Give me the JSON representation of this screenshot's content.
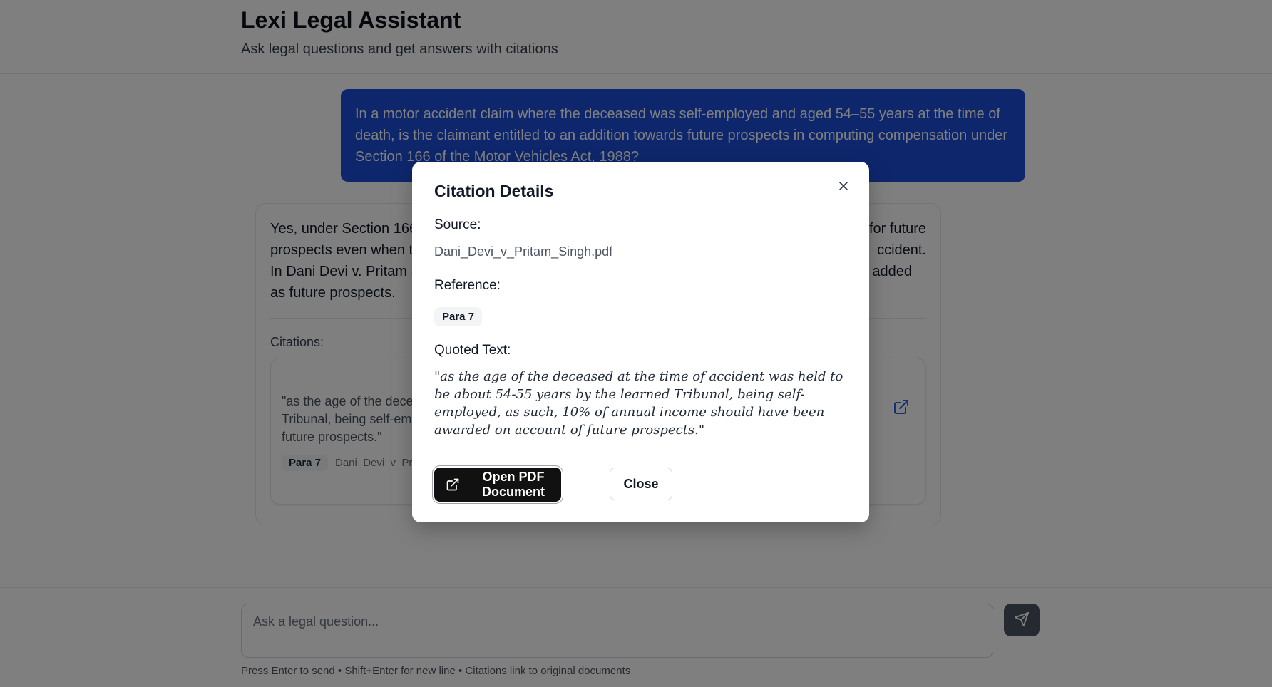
{
  "header": {
    "title": "Lexi Legal Assistant",
    "subtitle": "Ask legal questions and get answers with citations"
  },
  "conversation": {
    "user_message": "In a motor accident claim where the deceased was self-employed and aged 54–55 years at the time of death, is the claimant entitled to an addition towards future prospects in computing compensation under Section 166 of the Motor Vehicles Act, 1988?",
    "assistant_answer_visible_left": [
      "Yes, under Section 166",
      "prospects even when th",
      "In Dani Devi v. Pritam S",
      "as future prospects."
    ],
    "assistant_answer_visible_right": [
      "for future",
      "ccident.",
      "added"
    ],
    "citations_label": "Citations:",
    "citation": {
      "quote_visible_lines": [
        "\"as the age of the dece",
        "Tribunal, being self-emp",
        "future prospects.\""
      ],
      "para": "Para 7",
      "file_visible": "Dani_Devi_v_Prit"
    }
  },
  "modal": {
    "title": "Citation Details",
    "source_label": "Source:",
    "source_value": "Dani_Devi_v_Pritam_Singh.pdf",
    "reference_label": "Reference:",
    "reference_value": "Para 7",
    "quoted_label": "Quoted Text:",
    "quoted_value": "\"as the age of the deceased at the time of accident was held to be about 54-55 years by the learned Tribunal, being self-employed, as such, 10% of annual income should have been awarded on account of future prospects.\"",
    "open_pdf_label": "Open PDF Document",
    "close_label": "Close"
  },
  "composer": {
    "placeholder": "Ask a legal question...",
    "hint": "Press Enter to send • Shift+Enter for new line • Citations link to original documents"
  },
  "icons": {
    "close": "close-icon",
    "external_link": "external-link-icon",
    "send": "send-icon"
  },
  "colors": {
    "accent_blue": "#1d4ed8",
    "primary_dark": "#111111",
    "send_button": "#4b5563"
  }
}
